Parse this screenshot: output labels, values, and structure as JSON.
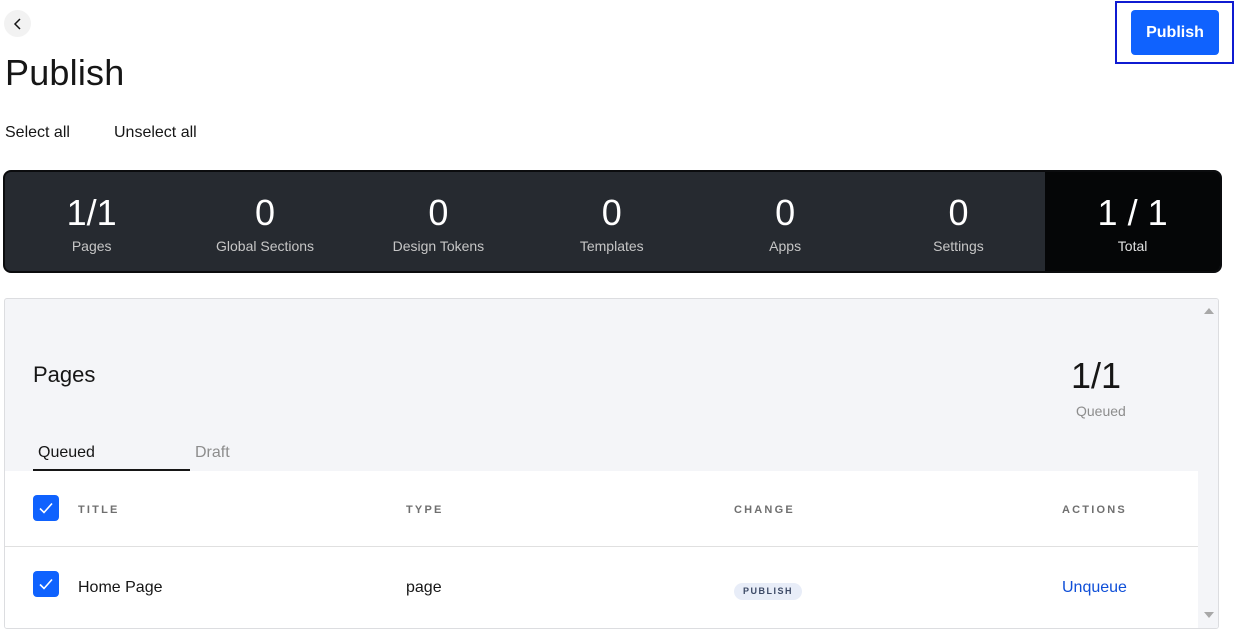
{
  "header": {
    "title": "Publish",
    "back_icon": "chevron-left-icon",
    "publish_label": "Publish"
  },
  "selection": {
    "select_all": "Select all",
    "unselect_all": "Unselect all"
  },
  "stats": [
    {
      "value": "1/1",
      "label": "Pages"
    },
    {
      "value": "0",
      "label": "Global Sections"
    },
    {
      "value": "0",
      "label": "Design Tokens"
    },
    {
      "value": "0",
      "label": "Templates"
    },
    {
      "value": "0",
      "label": "Apps"
    },
    {
      "value": "0",
      "label": "Settings"
    }
  ],
  "total": {
    "value": "1 / 1",
    "label": "Total"
  },
  "panel": {
    "title": "Pages",
    "queued_count": "1/1",
    "queued_label": "Queued",
    "tabs": [
      {
        "label": "Queued",
        "active": true
      },
      {
        "label": "Draft",
        "active": false
      }
    ],
    "table": {
      "columns": [
        "TITLE",
        "TYPE",
        "CHANGE",
        "ACTIONS"
      ],
      "rows": [
        {
          "checked": true,
          "title": "Home Page",
          "type": "page",
          "change": "PUBLISH",
          "action": "Unqueue"
        }
      ]
    }
  },
  "colors": {
    "accent": "#0f62fe",
    "stats_bg": "#262a30",
    "total_bg": "#050607",
    "link": "#0f4fd8"
  }
}
